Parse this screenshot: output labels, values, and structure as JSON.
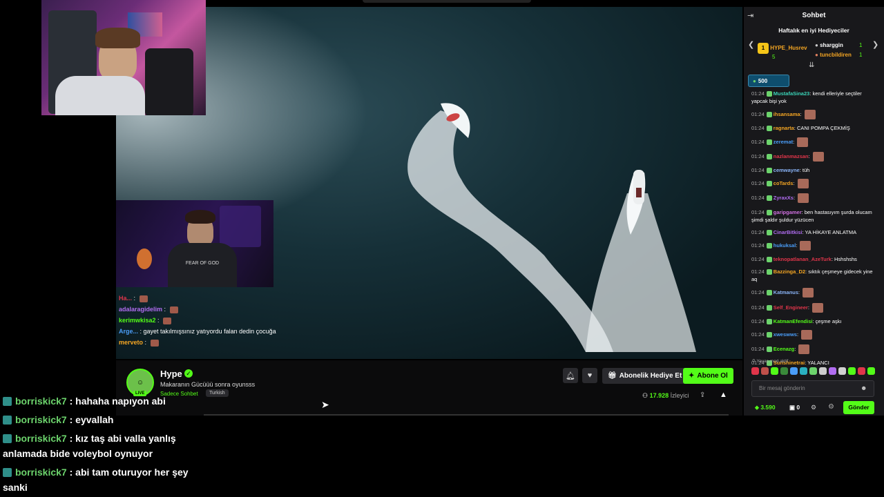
{
  "chat": {
    "title": "Sohbet",
    "gifters_title": "Haftalık en iyi Hediyeciler",
    "gifters": [
      {
        "rank": "1",
        "name": "HYPE_Husrev",
        "count": "5"
      },
      {
        "name": "sharggin",
        "count": "1"
      },
      {
        "name": "tuncbildiren",
        "count": "1"
      }
    ],
    "points_badge": "500",
    "messages": [
      {
        "time": "01:24",
        "nick": "MustafaSina23",
        "color": "#3ad3b7",
        "text": "kendi elleriyle seçtiler yapcak bişi yok",
        "emote": false
      },
      {
        "time": "01:24",
        "nick": "ihsansama",
        "color": "#f5a623",
        "text": "",
        "emote": true
      },
      {
        "time": "01:24",
        "nick": "ragnarta",
        "color": "#f5a623",
        "text": "CANI POMPA ÇEKMİŞ",
        "emote": false
      },
      {
        "time": "01:24",
        "nick": "zeremat",
        "color": "#4a9df8",
        "text": "",
        "emote": true
      },
      {
        "time": "01:24",
        "nick": "nazlanmazsan",
        "color": "#e0354a",
        "text": "",
        "emote": true
      },
      {
        "time": "01:24",
        "nick": "cemwayne",
        "color": "#8ab4f8",
        "text": "tüh",
        "emote": false
      },
      {
        "time": "01:24",
        "nick": "coTards",
        "color": "#f5a623",
        "text": "",
        "emote": true
      },
      {
        "time": "01:24",
        "nick": "ZyraxXs",
        "color": "#b06cf0",
        "text": "",
        "emote": true
      },
      {
        "time": "01:24",
        "nick": "garipgamer",
        "color": "#d070e0",
        "text": "ben hastasıyım şurda olucam şimdi şaldır şuldur yüzücen",
        "emote": false
      },
      {
        "time": "01:24",
        "nick": "CinarBitkisi",
        "color": "#b06cf0",
        "text": "YA HİKAYE ANLATMA",
        "emote": false
      },
      {
        "time": "01:24",
        "nick": "hukuksal",
        "color": "#4a9df8",
        "text": "",
        "emote": true
      },
      {
        "time": "01:24",
        "nick": "teknopatlanan_AzeTurk",
        "color": "#e0354a",
        "text": "Hshshshs",
        "emote": false
      },
      {
        "time": "01:24",
        "nick": "Bazzinga_D2",
        "color": "#f5a623",
        "text": "sıktık çeşmeye gidecek yine aq",
        "emote": false
      },
      {
        "time": "01:24",
        "nick": "Katmanus",
        "color": "#8ab4f8",
        "text": "",
        "emote": true
      },
      {
        "time": "01:24",
        "nick": "Self_Engineer",
        "color": "#e0354a",
        "text": "",
        "emote": true
      },
      {
        "time": "01:24",
        "nick": "KatmanEfendisi",
        "color": "#53fc18",
        "text": "çeşme aşkı",
        "emote": false
      },
      {
        "time": "01:24",
        "nick": "xweswws",
        "color": "#4a9df8",
        "text": "",
        "emote": true
      },
      {
        "time": "01:24",
        "nick": "Ecenazg",
        "color": "#53fc18",
        "text": "",
        "emote": true
      },
      {
        "time": "01:24",
        "nick": "Sunshinetrai",
        "color": "#f5a623",
        "text": "YALANCI",
        "emote": false
      }
    ],
    "slow_mode": "Yavaş mod aktif",
    "input_placeholder": "Bir mesaj gönderin",
    "kick_points": "3.590",
    "gift_count": "0",
    "send_label": "Gönder"
  },
  "stream": {
    "streamer": "Hype",
    "title": "Makaranın Gücüüü sonra oyunsss",
    "category": "Sadece Sohbet",
    "language": "Turkish",
    "live_label": "LIVE",
    "gift_sub_label": "Abonelik Hediye Et",
    "subscribe_label": "Abone Ol",
    "viewer_count": "17.928",
    "viewer_label": "İzleyici"
  },
  "overlay_chat": [
    {
      "nick": "Ha...",
      "text": ""
    },
    {
      "nick": "adalaragidelim",
      "text": ""
    },
    {
      "nick": "kerimwkisa2",
      "text": ""
    },
    {
      "nick": "Arge...",
      "text": "gayet takılmışsınız yatıyordu falan dedin çocuğa"
    },
    {
      "nick": "merveto",
      "text": ""
    }
  ],
  "bottom_chat": [
    {
      "nick": "borriskick7",
      "text": "hahaha napıyon abi"
    },
    {
      "nick": "borriskick7",
      "text": "eyvallah"
    },
    {
      "nick": "borriskick7",
      "text": "kız taş abi valla yanlış anlamada bide voleybol oynuyor"
    },
    {
      "nick": "borriskick7",
      "text": "abi tam oturuyor her şey sanki"
    }
  ],
  "webcam_shirt_text": "FEAR OF GOD",
  "colors": {
    "accent": "#53fc18",
    "panel": "#18181b"
  }
}
